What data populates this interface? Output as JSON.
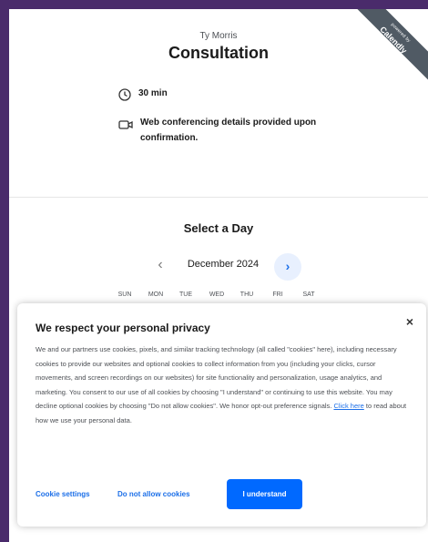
{
  "badge": {
    "small": "powered by",
    "big": "Calendly"
  },
  "event": {
    "host": "Ty Morris",
    "title": "Consultation",
    "duration": "30 min",
    "location": "Web conferencing details provided upon confirmation."
  },
  "calendar": {
    "heading": "Select a Day",
    "month": "December 2024",
    "prev_icon": "‹",
    "next_icon": "›",
    "weekdays": [
      "SUN",
      "MON",
      "TUE",
      "WED",
      "THU",
      "FRI",
      "SAT"
    ]
  },
  "cookie": {
    "title": "We respect your personal privacy",
    "body": "We and our partners use cookies, pixels, and similar tracking technology (all called \"cookies\" here), including necessary cookies to provide our websites and optional cookies to collect information from you (including your clicks, cursor movements, and screen recordings on our websites) for site functionality and personalization, usage analytics, and marketing. You consent to our use of all cookies by choosing \"I understand\" or continuing to use this website. You may decline optional cookies by choosing \"Do not allow cookies\". We honor opt-out preference signals.",
    "link": "Click here",
    "body_after": "to read about how we use your personal data.",
    "close": "×",
    "settings": "Cookie settings",
    "decline": "Do not allow cookies",
    "accept": "I understand"
  },
  "colors": {
    "accent": "#0069ff",
    "frame": "#4a2b6b"
  }
}
